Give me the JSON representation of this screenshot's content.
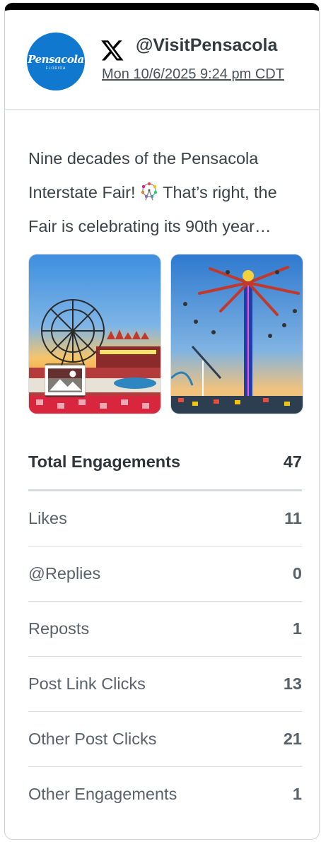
{
  "post": {
    "platform_icon": "x-logo-icon",
    "handle": "@VisitPensacola",
    "timestamp": "Mon 10/6/2025 9:24 pm CDT",
    "avatar": {
      "brand": "Pensacola",
      "sub": "FLORIDA",
      "color": "#1178d0"
    },
    "text_part1": "Nine decades of the Pensacola Interstate Fair! ",
    "emoji_icon": "ferris-wheel-icon",
    "text_part2": " That’s right, the Fair is celebrating its 90th year…",
    "images": [
      {
        "name": "ferris-wheel-photo",
        "badge_icon": "image-icon"
      },
      {
        "name": "swing-ride-photo"
      }
    ]
  },
  "metrics": {
    "total": {
      "label": "Total Engagements",
      "value": "47"
    },
    "rows": [
      {
        "label": "Likes",
        "value": "11"
      },
      {
        "label": "@Replies",
        "value": "0"
      },
      {
        "label": "Reposts",
        "value": "1"
      },
      {
        "label": "Post Link Clicks",
        "value": "13"
      },
      {
        "label": "Other Post Clicks",
        "value": "21"
      },
      {
        "label": "Other Engagements",
        "value": "1"
      }
    ]
  }
}
